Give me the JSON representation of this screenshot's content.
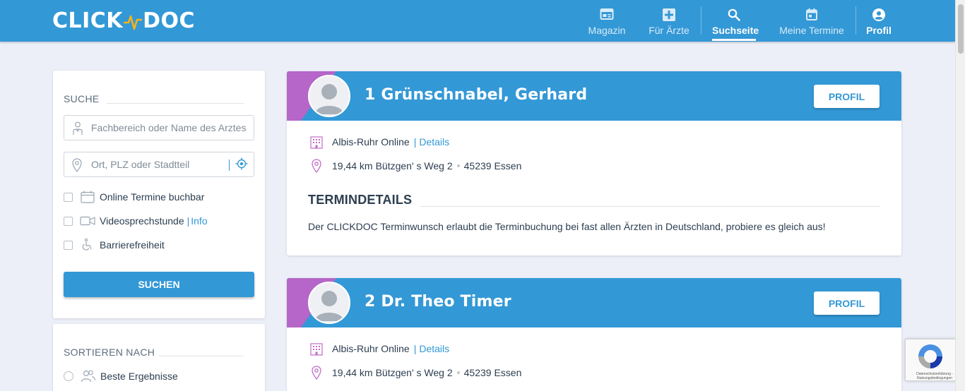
{
  "header": {
    "logo_left": "CLICK",
    "logo_right": "DOC",
    "nav": [
      {
        "label": "Magazin",
        "icon": "newspaper-icon"
      },
      {
        "label": "Für Ärzte",
        "icon": "medical-cross-icon"
      },
      {
        "label": "Suchseite",
        "icon": "search-icon",
        "active": true
      },
      {
        "label": "Meine Termine",
        "icon": "calendar-icon"
      },
      {
        "label": "Profil",
        "icon": "user-circle-icon"
      }
    ]
  },
  "search": {
    "title": "SUCHE",
    "specialty_placeholder": "Fachbereich oder Name des Arztes",
    "location_placeholder": "Ort, PLZ oder Stadtteil",
    "online_label": "Online Termine buchbar",
    "video_label": "Videosprechstunde",
    "video_info": "Info",
    "barrier_label": "Barrierefreiheit",
    "button": "SUCHEN"
  },
  "sort": {
    "title": "SORTIEREN NACH",
    "best_label": "Beste Ergebnisse"
  },
  "results": [
    {
      "name": "1 Grünschnabel, Gerhard",
      "profile_button": "PROFIL",
      "practice": "Albis-Ruhr Online",
      "details_link": "Details",
      "distance": "19,44 km",
      "street": "Bützgen' s Weg 2",
      "city": "45239 Essen",
      "section_title": "TERMINDETAILS",
      "description": "Der CLICKDOC Terminwunsch erlaubt die Terminbuchung bei fast allen Ärzten in Deutschland, probiere es gleich aus!"
    },
    {
      "name": "2 Dr. Theo Timer",
      "profile_button": "PROFIL",
      "practice": "Albis-Ruhr Online",
      "details_link": "Details",
      "distance": "19,44 km",
      "street": "Bützgen' s Weg 2",
      "city": "45239 Essen"
    }
  ],
  "recaptcha": {
    "text": "Datenschutzerklärung - Nutzungsbedingungen"
  },
  "colors": {
    "primary": "#3398d6",
    "accent_purple": "#b566c8",
    "background": "#eceef8",
    "logo_wave": "#f5b21b"
  }
}
